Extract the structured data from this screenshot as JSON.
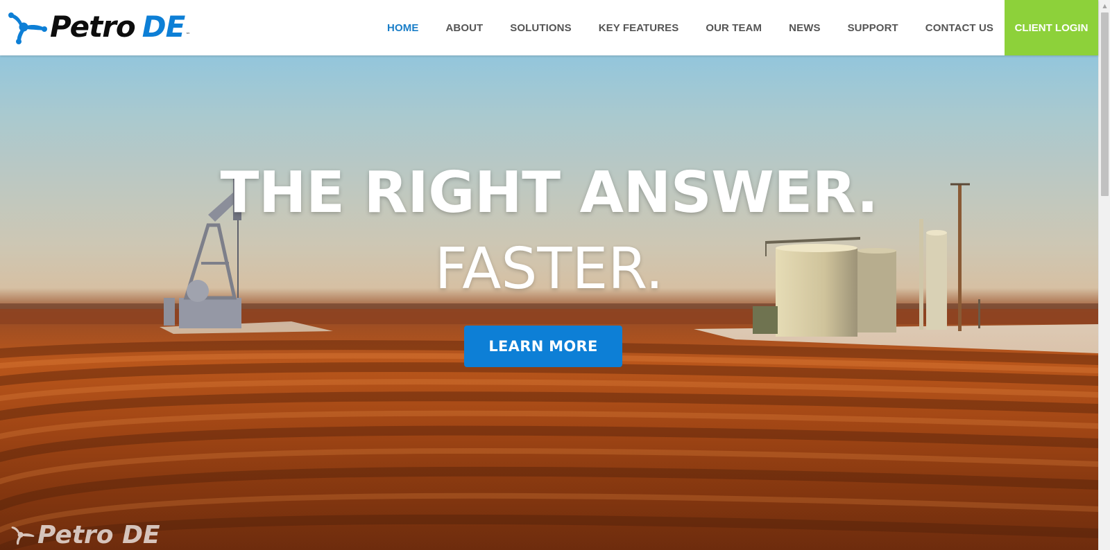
{
  "brand": {
    "word1": "Petro",
    "word2": "DE",
    "tm": "™",
    "primary_color": "#0d7fd6",
    "accent_color": "#8dd13a"
  },
  "nav": {
    "items": [
      {
        "label": "HOME",
        "active": true
      },
      {
        "label": "ABOUT"
      },
      {
        "label": "SOLUTIONS"
      },
      {
        "label": "KEY FEATURES"
      },
      {
        "label": "OUR TEAM"
      },
      {
        "label": "NEWS"
      },
      {
        "label": "SUPPORT"
      },
      {
        "label": "CONTACT US"
      }
    ],
    "client_login": "CLIENT LOGIN"
  },
  "hero": {
    "headline": "THE RIGHT ANSWER.",
    "subline": "FASTER.",
    "cta_label": "LEARN MORE",
    "watermark": "Petro DE",
    "background": "oilfield-landscape"
  }
}
